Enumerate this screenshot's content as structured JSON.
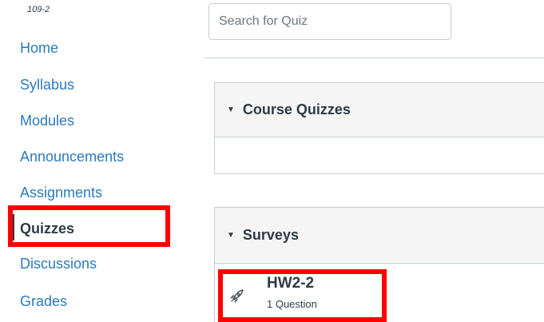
{
  "course": {
    "code": "109-2"
  },
  "nav": {
    "items": [
      {
        "label": "Home",
        "active": false
      },
      {
        "label": "Syllabus",
        "active": false
      },
      {
        "label": "Modules",
        "active": false
      },
      {
        "label": "Announcements",
        "active": false
      },
      {
        "label": "Assignments",
        "active": false
      },
      {
        "label": "Quizzes",
        "active": true
      },
      {
        "label": "Discussions",
        "active": false
      },
      {
        "label": "Grades",
        "active": false
      }
    ]
  },
  "search": {
    "placeholder": "Search for Quiz",
    "value": ""
  },
  "groups": [
    {
      "title": "Course Quizzes",
      "expanded": true,
      "quizzes": []
    },
    {
      "title": "Surveys",
      "expanded": true,
      "quizzes": [
        {
          "title": "HW2-2",
          "meta": "1 Question",
          "icon": "rocket-icon"
        }
      ]
    }
  ],
  "colors": {
    "link": "#2b7abc",
    "text": "#2d3b45",
    "highlight": "#ff0000",
    "header_bg": "#f5f5f5",
    "border": "#c7cdd1"
  }
}
